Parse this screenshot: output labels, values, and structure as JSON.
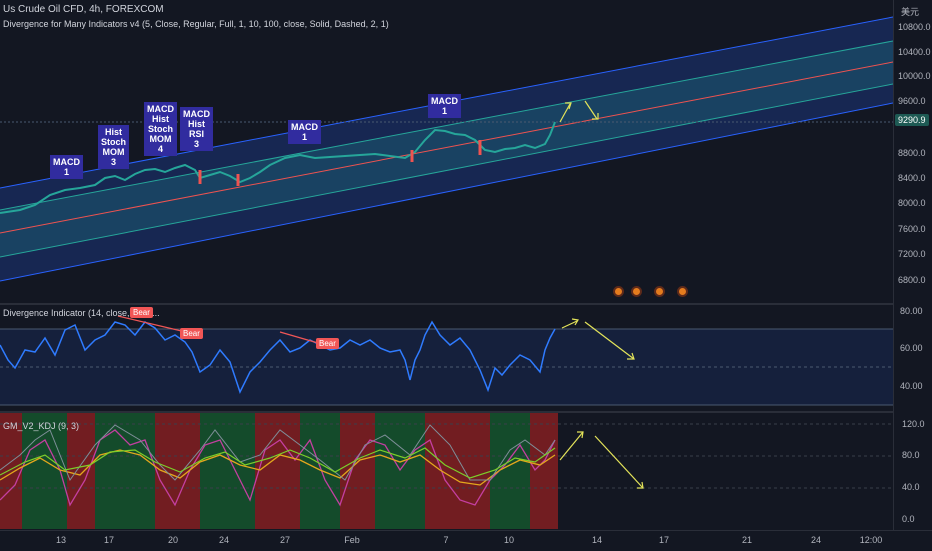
{
  "header": {
    "symbol_title": "Us Crude Oil CFD, 4h, FOREXCOM",
    "indicator1": "Divergence for Many Indicators v4 (5, Close, Regular, Full, 1, 10, 100, close, Solid, Dashed, 2, 1)",
    "currency": "美元"
  },
  "price_axis": {
    "ticks": [
      "10800.0",
      "10400.0",
      "10000.0",
      "9600.0",
      "8800.0",
      "8400.0",
      "8000.0",
      "7600.0",
      "7200.0",
      "6800.0"
    ],
    "current": "9290.9"
  },
  "pane2": {
    "title": "Divergence Indicator (14, close, 5, 5, ...",
    "ticks": [
      "80.00",
      "60.00",
      "40.00"
    ],
    "bear_label": "Bear"
  },
  "pane3": {
    "title": "GM_V2_KDJ (9, 3)",
    "ticks": [
      "120.0",
      "80.0",
      "40.0",
      "0.0"
    ]
  },
  "markers": [
    {
      "lines": [
        "MACD",
        "1"
      ]
    },
    {
      "lines": [
        "Hist",
        "Stoch",
        "MOM",
        "3"
      ]
    },
    {
      "lines": [
        "MACD",
        "Hist",
        "Stoch",
        "MOM",
        "4"
      ]
    },
    {
      "lines": [
        "MACD",
        "Hist",
        "RSI",
        "3"
      ]
    },
    {
      "lines": [
        "MACD",
        "1"
      ]
    },
    {
      "lines": [
        "MACD",
        "1"
      ]
    }
  ],
  "time_axis": [
    "13",
    "17",
    "20",
    "24",
    "27",
    "Feb",
    "7",
    "10",
    "14",
    "17",
    "21",
    "24",
    "12:00"
  ],
  "colors": {
    "background": "#131722",
    "up": "#26a69a",
    "down": "#ef5350",
    "channel": "#2962ff",
    "marker": "#312c9f",
    "arrow": "#e4e45a",
    "rsi": "#2f7bff"
  }
}
